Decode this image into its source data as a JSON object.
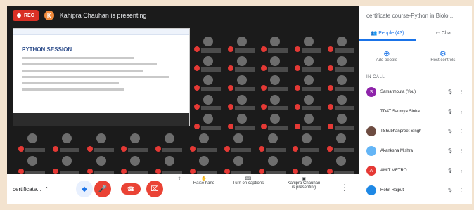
{
  "recording": {
    "label": "REC"
  },
  "presenter": {
    "initial": "K",
    "text": "Kahipra Chauhan is presenting"
  },
  "slide": {
    "title": "PYTHON SESSION"
  },
  "bottom": {
    "meeting_name": "certificate...",
    "raise_hand": "Raise hand",
    "captions": "Turn on captions",
    "presenting_line1": "Kahipra Chauhan",
    "presenting_line2": "is presenting"
  },
  "side": {
    "title": "certificate course-Python in Biolo...",
    "tabs": [
      {
        "label": "People (43)"
      },
      {
        "label": "Chat"
      }
    ],
    "actions": [
      {
        "label": "Add people"
      },
      {
        "label": "Host controls"
      }
    ],
    "section": "IN CALL",
    "people": [
      {
        "initial": "S",
        "name": "Samarmouta (You)",
        "color": "#8e24aa"
      },
      {
        "initial": "",
        "name": "TDAT Saumya Sinha",
        "color": "#ffffff"
      },
      {
        "initial": "",
        "name": "TShubhanpreet Singh",
        "color": "#6d4c41"
      },
      {
        "initial": "",
        "name": "Akanksha Mishra",
        "color": "#64b5f6"
      },
      {
        "initial": "A",
        "name": "AMIT METRO",
        "color": "#e53935"
      },
      {
        "initial": "",
        "name": "Rohit Rajput",
        "color": "#1e88e5"
      }
    ]
  }
}
